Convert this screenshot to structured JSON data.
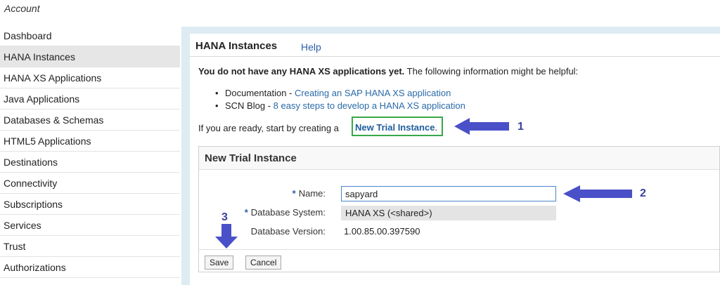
{
  "account_label": "Account",
  "sidebar": {
    "items": [
      {
        "label": "Dashboard",
        "name": "sidebar-item-dashboard",
        "active": false
      },
      {
        "label": "HANA Instances",
        "name": "sidebar-item-hana-instances",
        "active": true
      },
      {
        "label": "HANA XS Applications",
        "name": "sidebar-item-hana-xs-applications",
        "active": false
      },
      {
        "label": "Java Applications",
        "name": "sidebar-item-java-applications",
        "active": false
      },
      {
        "label": "Databases & Schemas",
        "name": "sidebar-item-databases-schemas",
        "active": false
      },
      {
        "label": "HTML5 Applications",
        "name": "sidebar-item-html5-applications",
        "active": false
      },
      {
        "label": "Destinations",
        "name": "sidebar-item-destinations",
        "active": false
      },
      {
        "label": "Connectivity",
        "name": "sidebar-item-connectivity",
        "active": false
      },
      {
        "label": "Subscriptions",
        "name": "sidebar-item-subscriptions",
        "active": false
      },
      {
        "label": "Services",
        "name": "sidebar-item-services",
        "active": false
      },
      {
        "label": "Trust",
        "name": "sidebar-item-trust",
        "active": false
      },
      {
        "label": "Authorizations",
        "name": "sidebar-item-authorizations",
        "active": false
      }
    ]
  },
  "main": {
    "title": "HANA Instances",
    "help_label": "Help",
    "info_bold": "You do not have any HANA XS applications yet.",
    "info_rest": " The following information might be helpful:",
    "bullets": [
      {
        "prefix": "Documentation - ",
        "link": "Creating an SAP HANA XS application"
      },
      {
        "prefix": "SCN Blog - ",
        "link": "8 easy steps to develop a HANA XS application"
      }
    ],
    "ready_text": "If you are ready, start by creating a",
    "new_trial_link": "New Trial Instance",
    "ready_end": "."
  },
  "dialog": {
    "title": "New Trial Instance",
    "name_label": "Name:",
    "name_value": "sapyard",
    "db_system_label": "Database System:",
    "db_system_value": "HANA XS (<shared>)",
    "db_version_label": "Database Version:",
    "db_version_value": "1.00.85.00.397590",
    "required_marker": "*",
    "save_label": "Save",
    "cancel_label": "Cancel"
  },
  "annotations": {
    "num1": "1",
    "num2": "2",
    "num3": "3"
  },
  "colors": {
    "accent_blue": "#2a6aa8",
    "annotation_arrow": "#4a50c8",
    "highlight_box": "#38a84a",
    "panel_background": "#dcecf2"
  }
}
